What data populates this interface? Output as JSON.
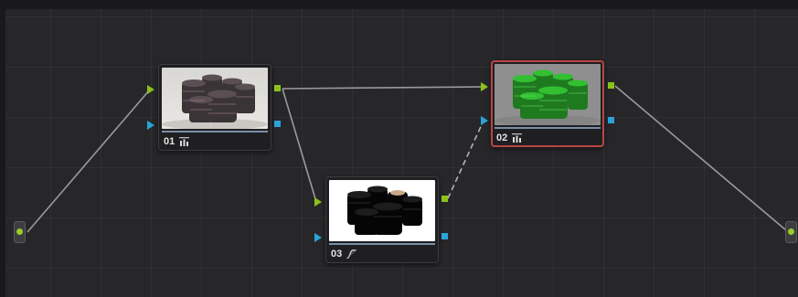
{
  "editor": {
    "title": ""
  },
  "nodes": [
    {
      "id": "01",
      "label": "01",
      "icon": "bars-icon",
      "selected": false,
      "thumbnail": "lens-photo-original"
    },
    {
      "id": "02",
      "label": "02",
      "icon": "bars-icon",
      "selected": true,
      "thumbnail": "lens-photo-green-tint"
    },
    {
      "id": "03",
      "label": "03",
      "icon": "curve-icon",
      "selected": false,
      "thumbnail": "lens-photo-key-matte"
    }
  ],
  "connections": [
    {
      "from": "source",
      "to": "01",
      "style": "solid"
    },
    {
      "from": "01",
      "to": "02",
      "style": "solid"
    },
    {
      "from": "01",
      "to": "03",
      "style": "solid"
    },
    {
      "from": "03",
      "to": "02",
      "style": "dashed"
    },
    {
      "from": "02",
      "to": "output",
      "style": "solid"
    }
  ],
  "colors": {
    "canvas": "#27272a",
    "rgb_port": "#8bc21a",
    "key_port": "#2aa4d8",
    "selected_border": "#b84646",
    "link": "#9a9a9c"
  }
}
